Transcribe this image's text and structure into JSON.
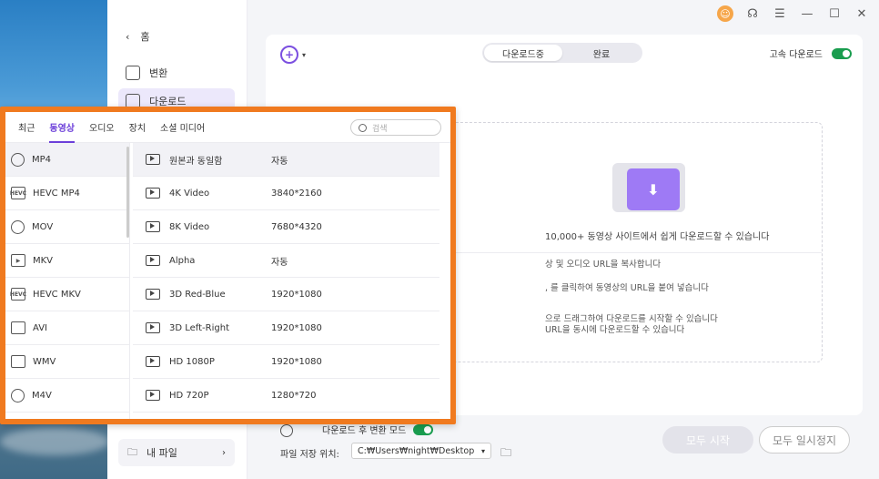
{
  "sidebar": {
    "home_label": "홈",
    "items": [
      {
        "label": "변환",
        "icon": "convert-icon"
      },
      {
        "label": "다운로드",
        "icon": "download-icon"
      }
    ],
    "my_files": "내 파일"
  },
  "main": {
    "segments": [
      "다운로드중",
      "완료"
    ],
    "active_segment": "다운로드중",
    "high_speed_label": "고속 다운로드",
    "dropzone": {
      "title": "10,000+ 동영상 사이트에서 쉽게 다운로드할 수 있습니다",
      "step1": "상 및 오디오 URL을 복사합니다",
      "step2": ", 를 클릭하여 동영상의 URL을 붙여 넣습니다",
      "step3a": "으로 드래그하여 다운로드를 시작할 수 있습니다",
      "step3b": "URL을 동시에 다운로드할 수 있습니다"
    },
    "convert_mode_label": "다운로드 후 변환 모드",
    "save_location_label": "파일 저장 위치:",
    "save_path": "C:₩Users₩night₩Desktop",
    "start_all": "모두 시작",
    "pause_all": "모두 일시정지"
  },
  "popup": {
    "tabs": [
      "최근",
      "동영상",
      "오디오",
      "장치",
      "소셜 미디어"
    ],
    "active_tab": "동영상",
    "search_placeholder": "검색",
    "formats": [
      {
        "label": "MP4",
        "icon": "disc-icon"
      },
      {
        "label": "HEVC MP4",
        "icon": "hevc-icon"
      },
      {
        "label": "MOV",
        "icon": "disc-icon"
      },
      {
        "label": "MKV",
        "icon": "video-icon"
      },
      {
        "label": "HEVC MKV",
        "icon": "hevc-icon"
      },
      {
        "label": "AVI",
        "icon": "film-icon"
      },
      {
        "label": "WMV",
        "icon": "film-icon"
      },
      {
        "label": "M4V",
        "icon": "disc-icon"
      }
    ],
    "active_format": "MP4",
    "presets": [
      {
        "name": "원본과 동일함",
        "res": "자동"
      },
      {
        "name": "4K Video",
        "res": "3840*2160"
      },
      {
        "name": "8K Video",
        "res": "7680*4320"
      },
      {
        "name": "Alpha",
        "res": "자동"
      },
      {
        "name": "3D Red-Blue",
        "res": "1920*1080"
      },
      {
        "name": "3D Left-Right",
        "res": "1920*1080"
      },
      {
        "name": "HD 1080P",
        "res": "1920*1080"
      },
      {
        "name": "HD 720P",
        "res": "1280*720"
      }
    ]
  },
  "colors": {
    "accent": "#6c3fd9",
    "popup_border": "#f07a1f",
    "toggle_on": "#1a9d4f"
  }
}
